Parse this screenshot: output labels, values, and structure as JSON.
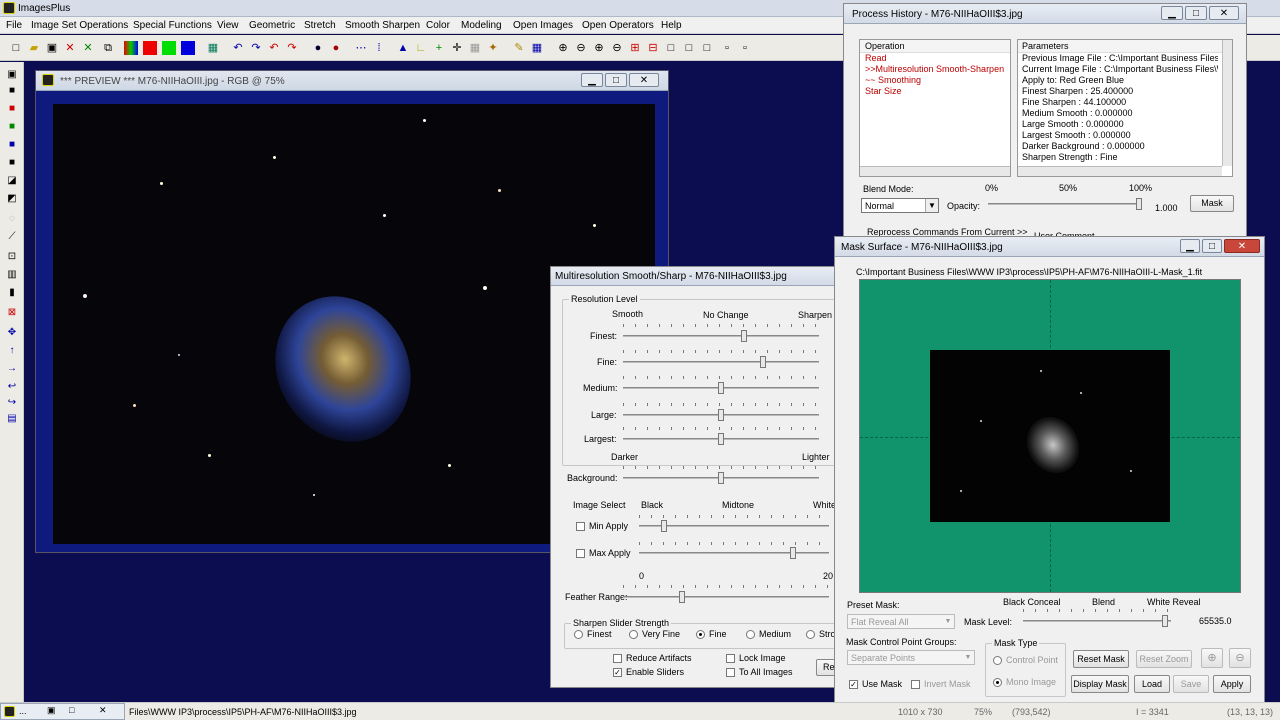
{
  "app": {
    "title": "ImagesPlus"
  },
  "menu": [
    "File",
    "Image Set Operations",
    "Special Functions",
    "View",
    "Geometric",
    "Stretch",
    "Smooth Sharpen",
    "Color",
    "Modeling",
    "Open Images",
    "Open Operators",
    "Help"
  ],
  "preview": {
    "title": "*** PREVIEW *** M76-NIIHaOIII.jpg - RGB @ 75%"
  },
  "history": {
    "title": "Process History - M76-NIIHaOIII$3.jpg",
    "operation_header": "Operation",
    "parameters_header": "Parameters",
    "operations": [
      "Read",
      ">>Multiresolution Smooth-Sharpen",
      "~~ Smoothing",
      "Star Size"
    ],
    "parameters": [
      "Previous Image File : C:\\Important Business Files\\WWW",
      "Current Image File : C:\\Important Business Files\\WWW",
      "Apply to:  Red Green Blue",
      "Finest Sharpen : 25.400000",
      "Fine Sharpen : 44.100000",
      "Medium Smooth : 0.000000",
      "Large Smooth : 0.000000",
      "Largest Smooth : 0.000000",
      "Darker Background : 0.000000",
      "Sharpen Strength : Fine"
    ],
    "blend_mode_label": "Blend Mode:",
    "blend_mode_value": "Normal",
    "opacity_label": "Opacity:",
    "opacity_ticks": [
      "0%",
      "50%",
      "100%"
    ],
    "opacity_value": "1.000",
    "opacity_level": 1.0,
    "mask_button": "Mask",
    "reprocess": "Reprocess Commands From Current >>",
    "user_comment": "User Comment"
  },
  "multires": {
    "title": "Multiresolution Smooth/Sharp - M76-NIIHaOIII$3.jpg",
    "resolution_group": "Resolution Level",
    "scale_labels": [
      "Smooth",
      "No Change",
      "Sharpen"
    ],
    "sliders": [
      {
        "label": "Finest:",
        "level": 0.62
      },
      {
        "label": "Fine:",
        "level": 0.72
      },
      {
        "label": "Medium:",
        "level": 0.5
      },
      {
        "label": "Large:",
        "level": 0.5
      },
      {
        "label": "Largest:",
        "level": 0.5
      }
    ],
    "bg_labels": [
      "Darker",
      "Lighter"
    ],
    "background_label": "Background:",
    "background_level": 0.5,
    "image_select": "Image Select",
    "bwm_labels": [
      "Black",
      "Midtone",
      "White"
    ],
    "min_apply": "Min Apply",
    "max_apply": "Max Apply",
    "min_level": 0.12,
    "max_level": 0.82,
    "range_labels": [
      "0",
      "20"
    ],
    "feather_label": "Feather Range:",
    "feather_level": 0.28,
    "sharpen_group": "Sharpen Slider Strength",
    "strengths": [
      "Finest",
      "Very Fine",
      "Fine",
      "Medium",
      "Stro"
    ],
    "strength_selected": "Fine",
    "reduce_artifacts": "Reduce Artifacts",
    "lock_image": "Lock Image",
    "enable_sliders": "Enable Sliders",
    "to_all_images": "To All Images",
    "re_button": "Re"
  },
  "mask": {
    "title": "Mask Surface - M76-NIIHaOIII$3.jpg",
    "path": "C:\\Important Business Files\\WWW IP3\\process\\IP5\\PH-AF\\M76-NIIHaOIII-L-Mask_1.fit",
    "preset_label": "Preset Mask:",
    "preset_value": "Flat Reveal All",
    "scale_labels": [
      "Black Conceal",
      "Blend",
      "White Reveal"
    ],
    "mask_level_label": "Mask Level:",
    "mask_level_value": "65535.0",
    "mask_level_fraction": 0.98,
    "cp_groups_label": "Mask Control Point Groups:",
    "cp_groups_value": "Separate Points",
    "mask_type_label": "Mask Type",
    "control_point": "Control Point",
    "mono_image": "Mono Image",
    "use_mask": "Use Mask",
    "invert_mask": "Invert Mask",
    "reset_mask": "Reset Mask",
    "reset_zoom": "Reset Zoom",
    "display_mask": "Display Mask",
    "load": "Load",
    "save": "Save",
    "apply": "Apply",
    "bg_color": "#11936b"
  },
  "status": {
    "path": "Files\\WWW IP3\\process\\IP5\\PH-AF\\M76-NIIHaOIII$3.jpg",
    "size": "1010 x 730",
    "zoom": "75%",
    "coords": "(793,542)",
    "intensity": "I = 3341",
    "rgb": "(13, 13, 13)"
  }
}
